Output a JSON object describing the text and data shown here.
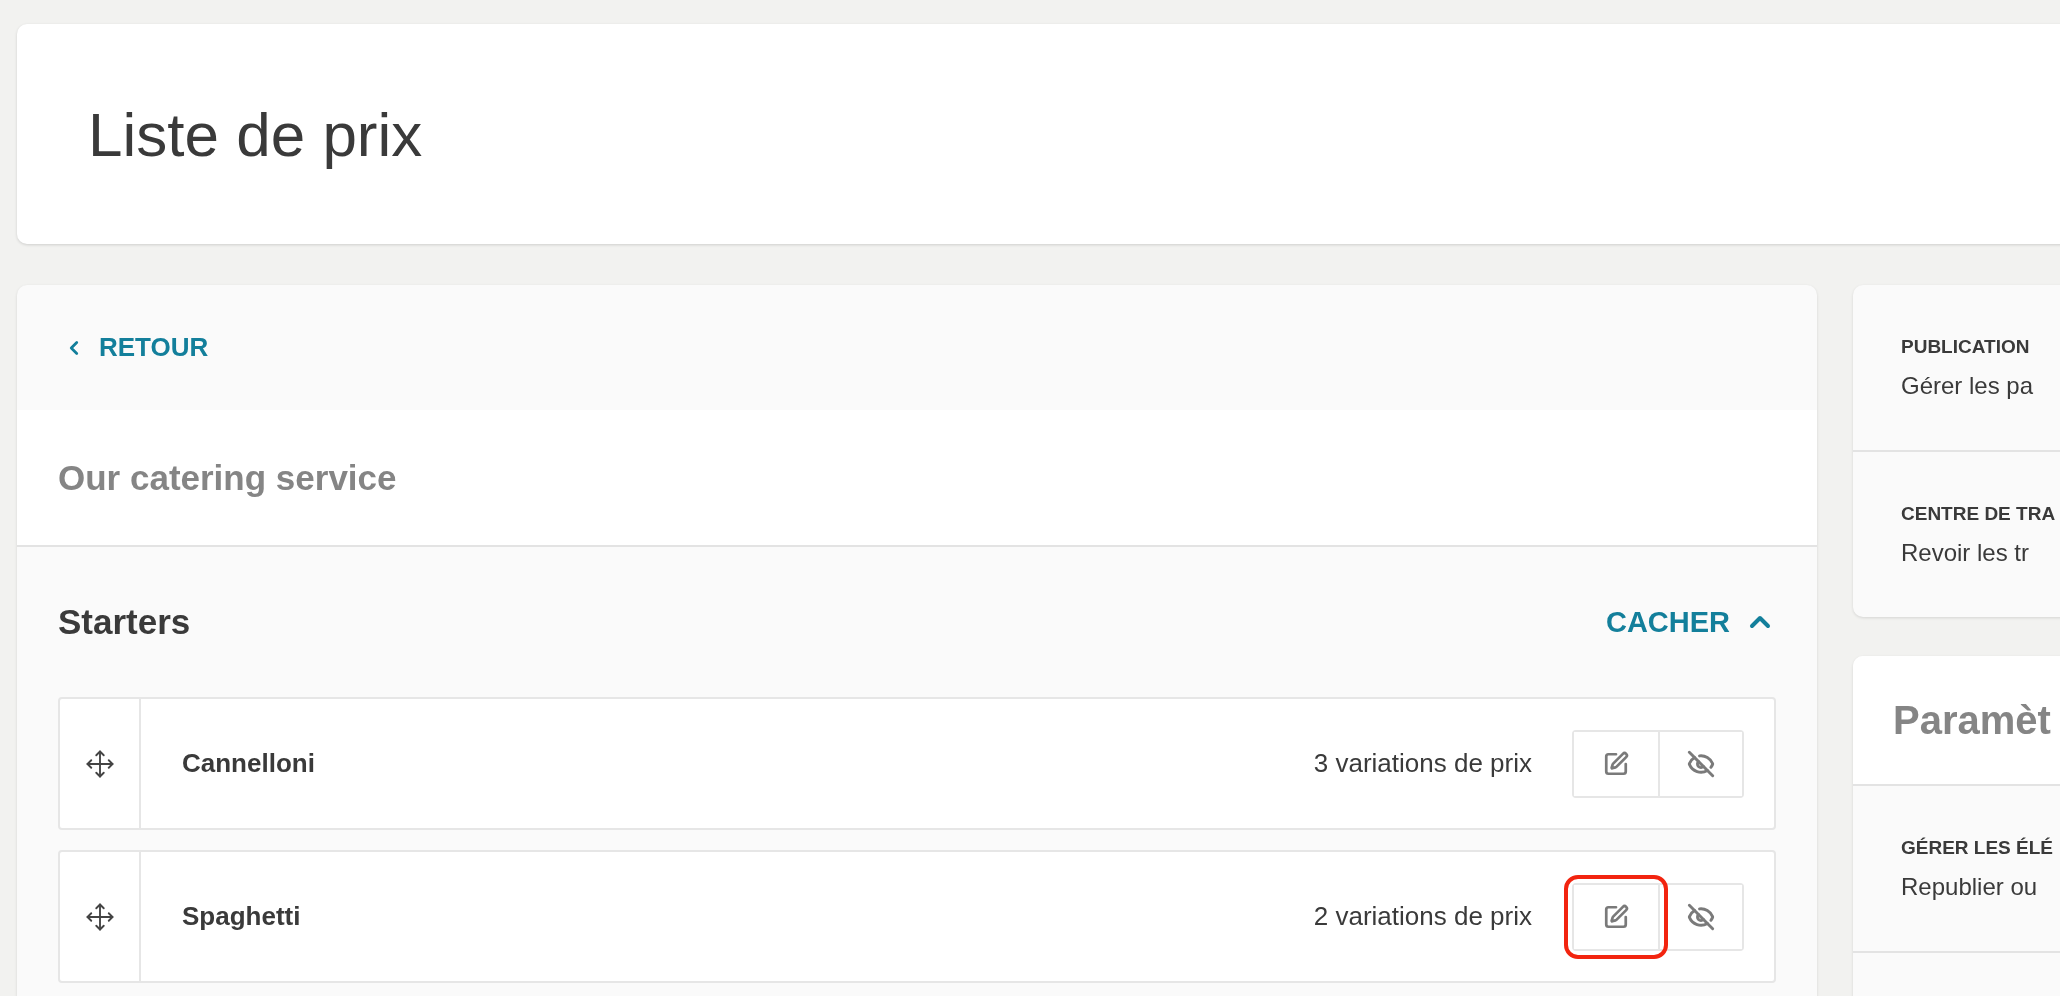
{
  "header": {
    "title": "Liste de prix"
  },
  "back_link": {
    "label": "RETOUR"
  },
  "menu": {
    "title": "Our catering service"
  },
  "section": {
    "title": "Starters",
    "toggle": {
      "label": "CACHER",
      "expanded": true
    },
    "items": [
      {
        "name": "Cannelloni",
        "variations": "3 variations de prix",
        "edit_highlighted": false
      },
      {
        "name": "Spaghetti",
        "variations": "2 variations de prix",
        "edit_highlighted": true
      }
    ]
  },
  "sidebar": {
    "cards": [
      {
        "entries": [
          {
            "label": "PUBLICATION",
            "description": "Gérer les pa"
          },
          {
            "label": "CENTRE DE TRA",
            "description": "Revoir les tr"
          }
        ]
      },
      {
        "title": "Paramèt",
        "entries": [
          {
            "label": "GÉRER LES ÉLÉ",
            "description": "Republier ou"
          }
        ],
        "more": true
      }
    ]
  }
}
